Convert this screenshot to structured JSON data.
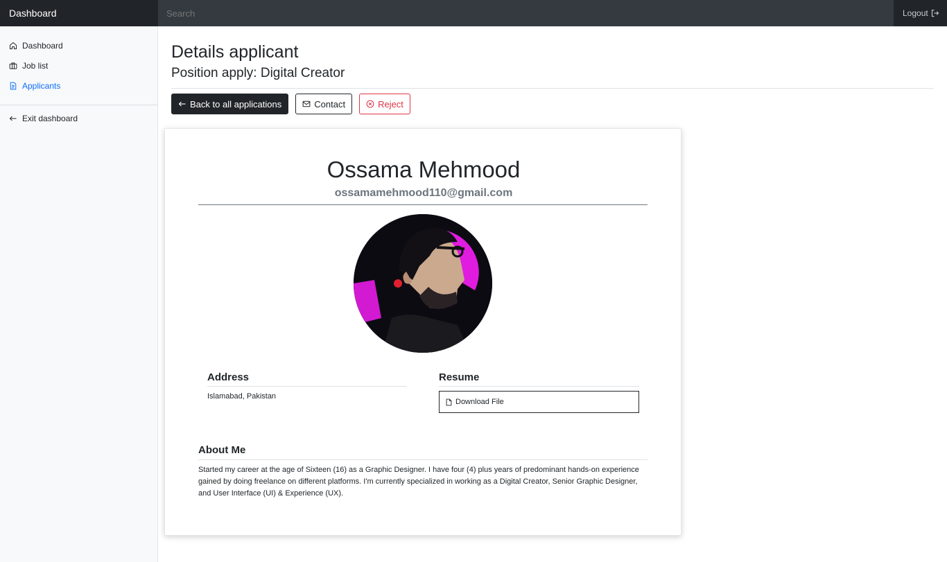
{
  "navbar": {
    "brand": "Dashboard",
    "search_placeholder": "Search",
    "logout_label": "Logout"
  },
  "sidebar": {
    "items": [
      {
        "label": "Dashboard",
        "icon": "home-icon"
      },
      {
        "label": "Job list",
        "icon": "briefcase-icon"
      },
      {
        "label": "Applicants",
        "icon": "file-text-icon",
        "active": true
      }
    ],
    "exit_label": "Exit dashboard"
  },
  "page": {
    "title": "Details applicant",
    "subtitle": "Position apply: Digital Creator",
    "buttons": {
      "back": "Back to all applications",
      "contact": "Contact",
      "reject": "Reject"
    }
  },
  "applicant": {
    "name": "Ossama Mehmood",
    "email": "ossamamehmood110@gmail.com",
    "address_title": "Address",
    "address": "Islamabad, Pakistan",
    "resume_title": "Resume",
    "resume_label": "Download File",
    "about_title": "About Me",
    "about": "Started my career at the age of Sixteen (16) as a Graphic Designer. I have four (4) plus years of predominant hands-on experience gained by doing freelance on different platforms. I'm currently specialized in working as a Digital Creator, Senior Graphic Designer, and User Interface (UI) & Experience (UX)."
  },
  "colors": {
    "accent": "#0d6efd",
    "danger": "#dc3545",
    "navbar": "#343a40",
    "brand_bg": "#212529"
  }
}
